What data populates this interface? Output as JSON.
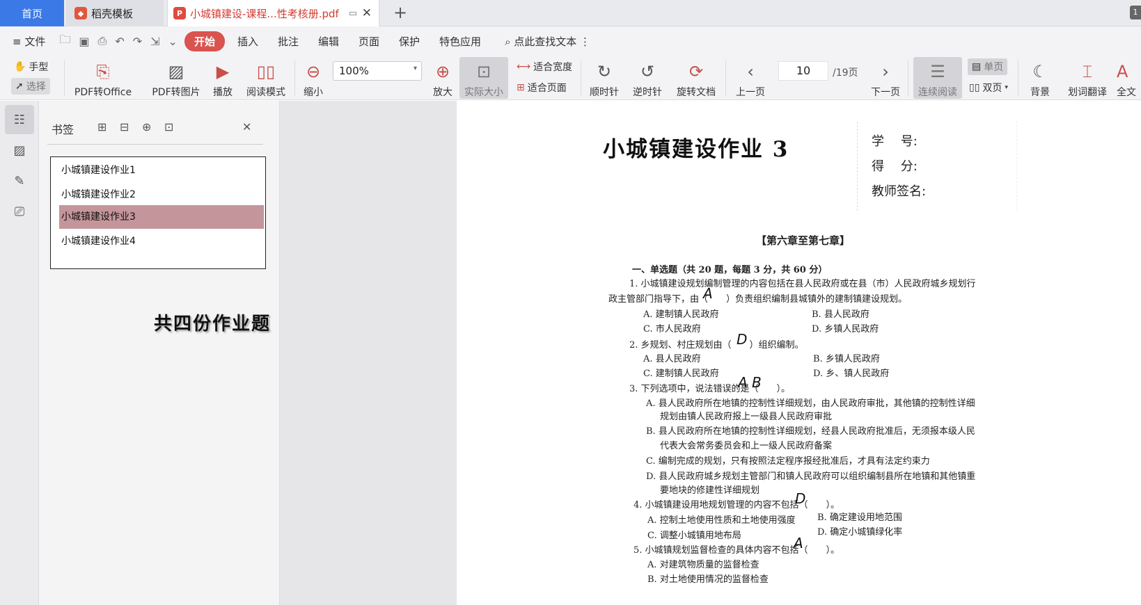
{
  "tabs": {
    "home": "首页",
    "templates": "稻壳模板",
    "document": "小城镇建设-课程...性考核册.pdf"
  },
  "menu": {
    "file": "文件",
    "items": [
      "开始",
      "插入",
      "批注",
      "编辑",
      "页面",
      "保护",
      "特色应用"
    ],
    "search": "点此查找文本"
  },
  "toolbar": {
    "hand": "手型",
    "select": "选择",
    "pdf_to_office": "PDF转Office",
    "pdf_to_image": "PDF转图片",
    "play": "播放",
    "read_mode": "阅读模式",
    "zoom_out": "缩小",
    "zoom_value": "100%",
    "zoom_in": "放大",
    "actual_size": "实际大小",
    "fit_width": "适合宽度",
    "fit_page": "适合页面",
    "clockwise": "顺时针",
    "counterclockwise": "逆时针",
    "rotate": "旋转文档",
    "prev_page": "上一页",
    "page_current": "10",
    "page_total": "/19页",
    "next_page": "下一页",
    "continuous": "连续阅读",
    "single": "单页",
    "double": "双页",
    "background": "背景",
    "translate": "划词翻译",
    "fulltext": "全文"
  },
  "bookmarks": {
    "title": "书签",
    "items": [
      "小城镇建设作业1",
      "小城镇建设作业2",
      "小城镇建设作业3",
      "小城镇建设作业4"
    ],
    "note": "共四份作业题"
  },
  "document": {
    "title": "小城镇建设作业 3",
    "student_no": "学　 号:",
    "score": "得　 分:",
    "teacher": "教师签名:",
    "chapter": "【第六章至第七章】",
    "lines": [
      "一、单选题（共 20 题，每题 3 分，共 60 分）",
      "1. 小城镇建设规划编制管理的内容包括在县人民政府或在县（市）人民政府城乡规划行",
      "政主管部门指导下，由（　　）负责组织编制县城镇外的建制镇建设规划。",
      "A. 建制镇人民政府",
      "B. 县人民政府",
      "C. 市人民政府",
      "D. 乡镇人民政府",
      "2. 乡规划、村庄规划由（　　）组织编制。",
      "A. 县人民政府",
      "B. 乡镇人民政府",
      "C. 建制镇人民政府",
      "D. 乡、镇人民政府",
      "3. 下列选项中，说法错误的是（　　）。",
      "A. 县人民政府所在地镇的控制性详细规划，由人民政府审批，其他镇的控制性详细",
      "规划由镇人民政府报上一级县人民政府审批",
      "B. 县人民政府所在地镇的控制性详细规划，经县人民政府批准后，无须报本级人民",
      "代表大会常务委员会和上一级人民政府备案",
      "C. 编制完成的规划，只有按照法定程序报经批准后，才具有法定约束力",
      "D. 县人民政府城乡规划主管部门和镇人民政府可以组织编制县所在地镇和其他镇重",
      "要地块的修建性详细规划",
      "4. 小城镇建设用地规划管理的内容不包括（　　）。",
      "A. 控制土地使用性质和土地使用强度",
      "B. 确定建设用地范围",
      "C. 调整小城镇用地布局",
      "D. 确定小城镇绿化率",
      "5. 小城镇规划监督检查的具体内容不包括（　　）。",
      "A. 对建筑物质量的监督检查",
      "B. 对土地使用情况的监督检查"
    ],
    "handwritten": [
      "A",
      "D",
      "A B",
      "D",
      "A"
    ]
  }
}
